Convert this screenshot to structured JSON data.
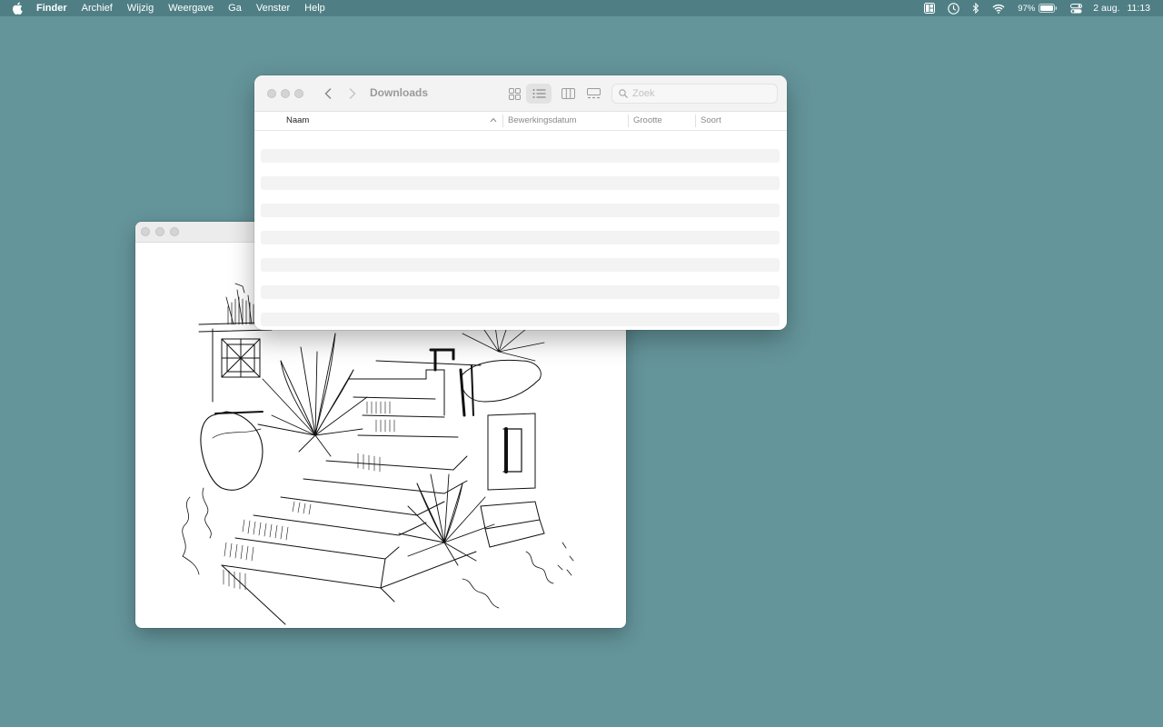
{
  "menubar": {
    "app_name": "Finder",
    "menus": [
      "Archief",
      "Wijzig",
      "Weergave",
      "Ga",
      "Venster",
      "Help"
    ],
    "status_icons": [
      "window-layout-icon",
      "clock-icon",
      "bluetooth-icon",
      "wifi-icon"
    ],
    "battery_percent": "97%",
    "control_center_icon": "control-center-icon",
    "date": "2 aug.",
    "time": "11:13"
  },
  "finder": {
    "title": "Downloads",
    "search_placeholder": "Zoek",
    "columns": [
      "Naam",
      "Bewerkingsdatum",
      "Grootte",
      "Soort"
    ],
    "sorted_column": "Naam",
    "view_modes": [
      "icon-view",
      "list-view",
      "column-view",
      "gallery-view"
    ],
    "active_view": "list-view",
    "rows": []
  },
  "preview": {
    "content": "architectural-sketch-of-garden-stairs-image"
  },
  "colors": {
    "desktop": "#64959b",
    "menubar": "#4f7f85",
    "row_stripe": "#f3f3f3"
  }
}
